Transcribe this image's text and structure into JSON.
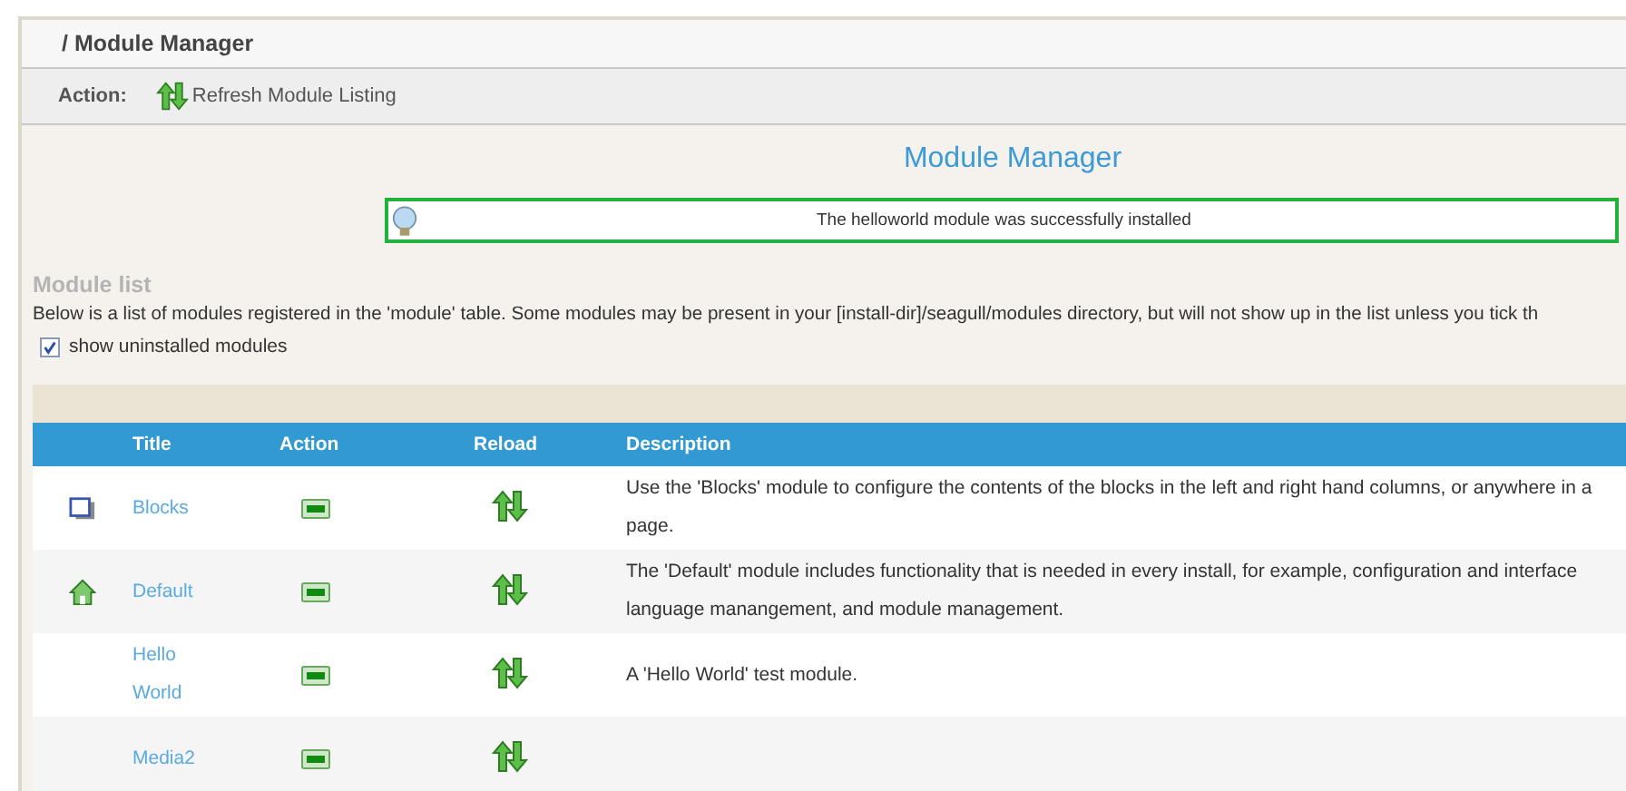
{
  "breadcrumb": "/ Module Manager",
  "action_bar": {
    "label": "Action:",
    "link": "Refresh Module Listing"
  },
  "heading": "Module Manager",
  "message": "The helloworld module was successfully installed",
  "section_title": "Module list",
  "intro": "Below is a list of modules registered in the 'module' table. Some modules may be present in your [install-dir]/seagull/modules directory, but will not show up in the list unless you tick th",
  "show_uninstalled": {
    "label": "show uninstalled modules",
    "checked": true
  },
  "table": {
    "columns": [
      "Title",
      "Action",
      "Reload",
      "Description"
    ],
    "rows": [
      {
        "kind": "blocks",
        "title": "Blocks",
        "description": "Use the 'Blocks' module to configure the contents of the blocks in the left and right hand columns, or anywhere in a page."
      },
      {
        "kind": "home",
        "title": "Default",
        "description": "The 'Default' module includes functionality that is needed in every install, for example, configuration and interface language manangement, and module management."
      },
      {
        "kind": "plain",
        "title": "Hello World",
        "description": "A 'Hello World' test module."
      },
      {
        "kind": "plain",
        "title": "Media2"
      }
    ]
  }
}
